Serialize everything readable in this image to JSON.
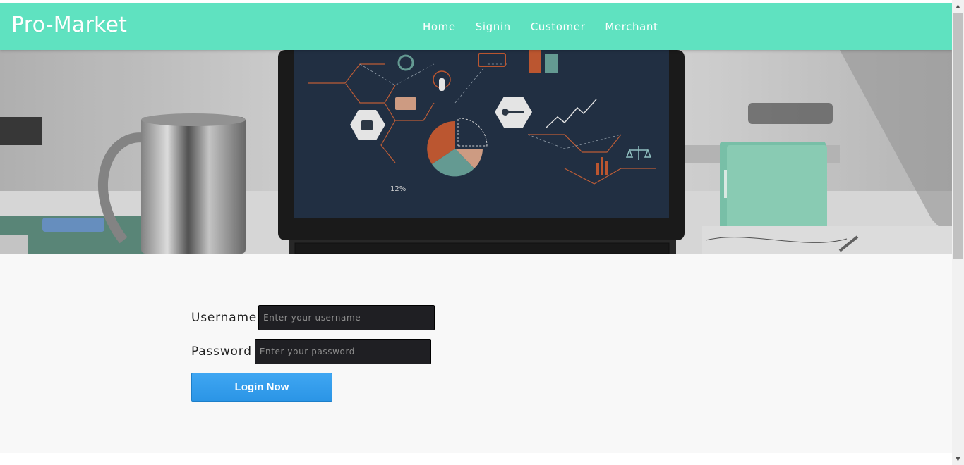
{
  "brand": {
    "title": "Pro-Market"
  },
  "nav": {
    "items": [
      {
        "label": "Home"
      },
      {
        "label": "Signin"
      },
      {
        "label": "Customer"
      },
      {
        "label": "Merchant"
      }
    ]
  },
  "hero": {
    "chart_label": "12%"
  },
  "form": {
    "username_label": "Username",
    "username_placeholder": "Enter your username",
    "username_value": "",
    "password_label": "Password",
    "password_placeholder": "Enter your password",
    "password_value": "",
    "login_label": "Login Now"
  },
  "scrollbar": {
    "up_icon": "▲",
    "down_icon": "▼"
  },
  "colors": {
    "navbar": "#5fe2c0",
    "login_button": "#3aa1ef",
    "input_background": "#1f1f23",
    "content_background": "#f8f8f8"
  }
}
